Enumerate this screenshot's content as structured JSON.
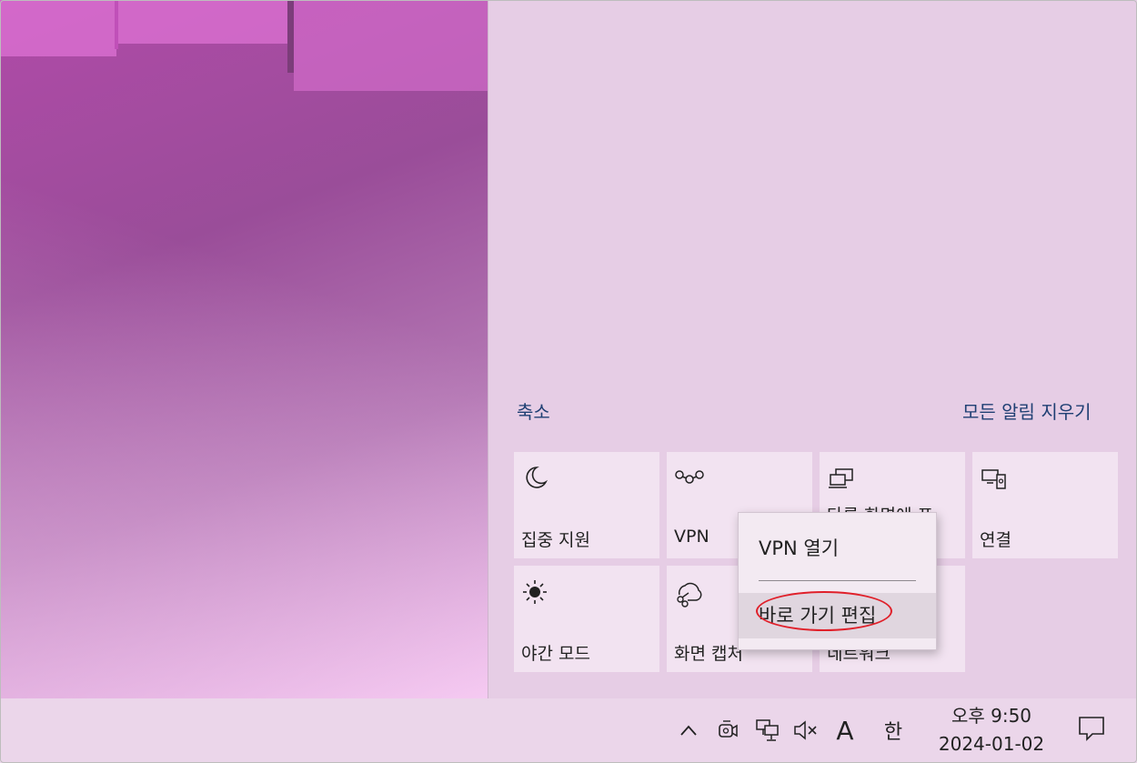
{
  "action_center": {
    "collapse_label": "축소",
    "clear_all_label": "모든 알림 지우기",
    "tiles": [
      {
        "label": "집중 지원",
        "icon": "moon-icon"
      },
      {
        "label": "VPN",
        "icon": "vpn-icon"
      },
      {
        "label": "다른 화면에 표",
        "icon": "project-icon"
      },
      {
        "label": "연결",
        "icon": "connect-icon"
      },
      {
        "label": "야간 모드",
        "icon": "brightness-icon"
      },
      {
        "label": "화면 캡처",
        "icon": "snip-icon"
      },
      {
        "label": "네트워크",
        "icon": "network-icon"
      }
    ]
  },
  "context_menu": {
    "items": [
      "VPN 열기",
      "바로 가기 편집"
    ]
  },
  "taskbar": {
    "ime_letter": "A",
    "ime_lang": "한",
    "time": "오후 9:50",
    "date": "2024-01-02",
    "icons": [
      "chevron-up-icon",
      "meet-now-icon",
      "network-icon",
      "speaker-muted-icon",
      "notification-icon"
    ]
  },
  "colors": {
    "accent_link": "#1f3f73",
    "highlight_ring": "#e0202a"
  }
}
